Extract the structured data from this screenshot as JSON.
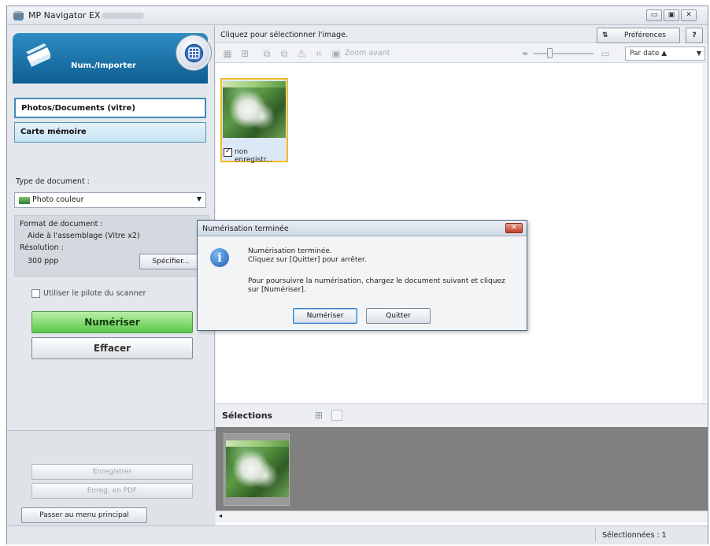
{
  "window": {
    "title": "MP Navigator EX -",
    "controls": [
      "▭",
      "▣",
      "✕"
    ]
  },
  "left": {
    "header_label": "Num./Importer",
    "tabs": [
      "Photos/Documents (vitre)",
      "Carte mémoire"
    ],
    "doc_type_label": "Type de document :",
    "doc_type_value": "Photo couleur",
    "doc_format_label": "Format de document :",
    "doc_format_value": "Aide à l'assemblage (Vitre x2)",
    "resolution_label": "Résolution :",
    "resolution_value": "300 ppp",
    "specify_label": "Spécifier...",
    "scanner_driver_label": "Utiliser le pilote du scanner",
    "scan_label": "Numériser",
    "clear_label": "Effacer",
    "save_label": "Enregistrer",
    "save_pdf_label": "Enreg. en PDF",
    "main_menu_label": "Passer au menu principal"
  },
  "right": {
    "instruction": "Cliquez pour sélectionner l'image.",
    "preferences_label": "Préférences",
    "help_label": "?",
    "sort_label": "Par date ▲",
    "zoom_label": "Zoom avant",
    "thumb_caption": "non enregistr...",
    "selections_label": "Sélections",
    "status": "Sélectionnées : 1"
  },
  "dialog": {
    "title": "Numérisation terminée",
    "line1": "Numérisation terminée.",
    "line2": "Cliquez sur [Quitter] pour arrêter.",
    "line3": "Pour poursuivre la numérisation, chargez le document suivant et cliquez",
    "line4": "sur [Numériser].",
    "scan_btn": "Numériser",
    "quit_btn": "Quitter"
  }
}
